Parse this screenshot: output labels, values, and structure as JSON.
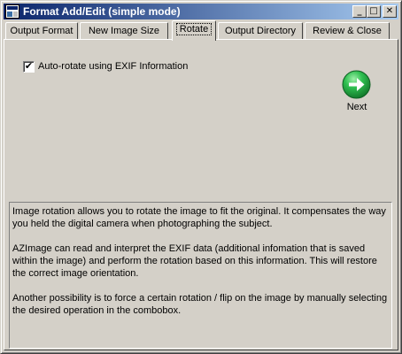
{
  "window": {
    "title": "Format Add/Edit (simple mode)",
    "controls": {
      "minimize": "_",
      "maximize": "□",
      "close": "✕"
    }
  },
  "tabs": [
    {
      "label": "Output Format",
      "active": false
    },
    {
      "label": "New Image Size",
      "active": false
    },
    {
      "label": "Rotate",
      "active": true
    },
    {
      "label": "Output Directory",
      "active": false
    },
    {
      "label": "Review & Close",
      "active": false
    }
  ],
  "rotate": {
    "auto_rotate": {
      "label": "Auto-rotate using EXIF Information",
      "checked": true,
      "mark": "✔"
    },
    "next": {
      "label": "Next",
      "icon": "green-arrow-right-icon"
    },
    "info": [
      "Image rotation allows you to rotate the image to fit the original. It compensates the way you held the digital camera when photographing the subject.",
      "AZImage can read and interpret the EXIF data (additional infomation that is saved within the image) and perform the rotation based on this information. This will restore the correct image orientation.",
      "Another possibility is to force a certain rotation / flip on the image by manually selecting the desired operation in the combobox."
    ]
  },
  "colors": {
    "title_start": "#0a246a",
    "title_end": "#a6caf0",
    "face": "#d4d0c8",
    "next_green": "#2aa64a"
  }
}
